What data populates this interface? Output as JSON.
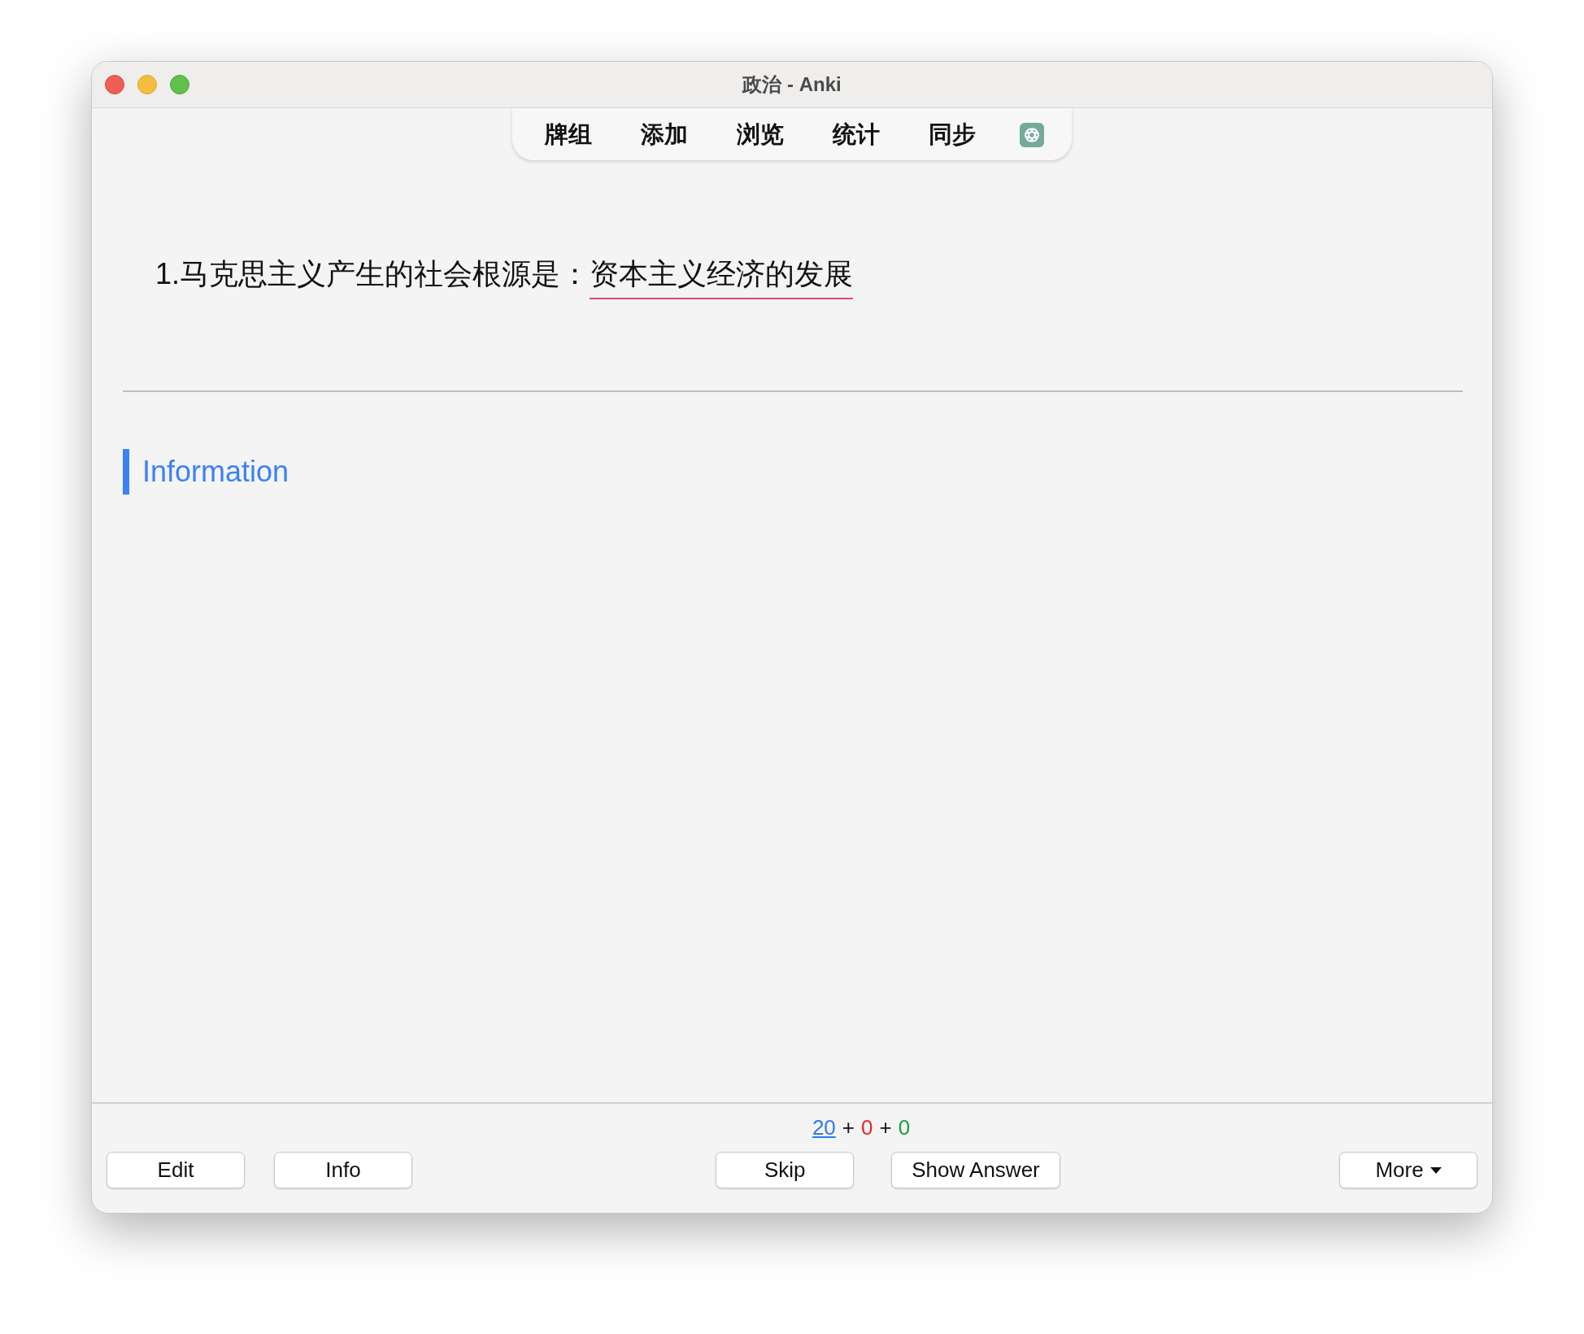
{
  "window": {
    "title": "政治 - Anki"
  },
  "toolbar": {
    "items": [
      {
        "label": "牌组"
      },
      {
        "label": "添加"
      },
      {
        "label": "浏览"
      },
      {
        "label": "统计"
      },
      {
        "label": "同步"
      }
    ]
  },
  "card": {
    "question": "1.马克思主义产生的社会根源是：",
    "answer": "资本主义经济的发展",
    "section": "Information"
  },
  "counts": {
    "items": [
      {
        "value": "20",
        "color": "#2f7bea",
        "link": true
      },
      {
        "value": "0",
        "color": "#e8262b",
        "link": false
      },
      {
        "value": "0",
        "color": "#1e9e3a",
        "link": false
      }
    ],
    "separators": [
      "+",
      "+"
    ]
  },
  "buttons": {
    "left": [
      {
        "label": "Edit"
      },
      {
        "label": "Info"
      }
    ],
    "center": [
      {
        "label": "Skip"
      },
      {
        "label": "Show Answer"
      }
    ],
    "right": [
      {
        "label": "More",
        "caret": true
      }
    ]
  }
}
